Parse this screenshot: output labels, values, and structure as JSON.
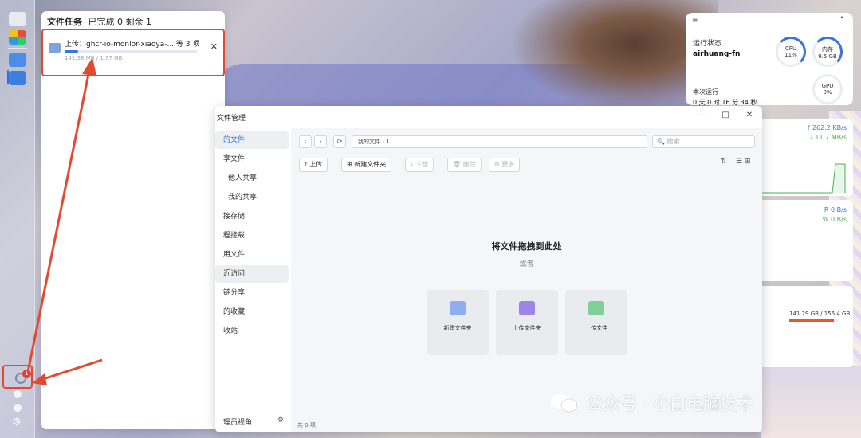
{
  "task_panel": {
    "title": "文件任务",
    "summary": "已完成 0 剩余 1",
    "item": {
      "name": "上传：ghcr-io-monlor-xiaoya-...  等 3 项",
      "size": "141.38 MB / 1.37 GB",
      "progress": 0.1,
      "close": "✕"
    }
  },
  "dock": {
    "task_badge": "1",
    "settings_icon": "⚙"
  },
  "monitor": {
    "collapse": "⌃",
    "header_icon": "≡",
    "status_label": "运行状态",
    "host": "airhuang-fn",
    "cpu_label": "CPU",
    "cpu_value": "11%",
    "mem_label": "内存",
    "mem_value": "9.5 GB",
    "gpu_label": "GPU",
    "gpu_value": "0%",
    "uptime_label": "本次运行",
    "uptime_value": "0 天 0 时 16 分 34 秒",
    "net_up": "⤒ 262.2 KB/s",
    "net_down": "⤓ 11.7 MB/s",
    "disk_read": "R 0 B/s",
    "disk_write": "W 0 B/s",
    "storage": "141.29 GB / 156.4 GB",
    "storage_fraction": 0.9
  },
  "file_manager": {
    "title": "文件管理",
    "sidebar": [
      "的文件",
      "享文件",
      "他人共享",
      "我的共享",
      "接存储",
      "程挂载",
      "用文件",
      "近访问",
      "链分享",
      "的收藏",
      "收站"
    ],
    "sidebar_footer": "理员视角",
    "sidebar_footer_icon": "⚙",
    "nav": {
      "back": "‹",
      "forward": "›",
      "refresh": "⟳"
    },
    "path": "我的文件 › 1",
    "search_placeholder": "🔍 搜索",
    "toolbar": {
      "upload": "⤒ 上传",
      "new_folder": "⊞ 新建文件夹",
      "download": "⤓ 下载",
      "delete": "🗑 删除",
      "more": "⊖ 更多"
    },
    "sort_icon": "⇅",
    "view_icon": "☰ ⊞",
    "window": {
      "minimize": "—",
      "maximize": "□",
      "close": "✕"
    },
    "drop_title": "将文件拖拽到此处",
    "drop_or": "或者",
    "actions": [
      "新建文件夹",
      "上传文件夹",
      "上传文件"
    ],
    "status": "共 0 项"
  },
  "watermark": "公众号 · 小白电脑技术",
  "colors": {
    "accent": "#2f6fe4",
    "annotation": "#e24a2f"
  }
}
